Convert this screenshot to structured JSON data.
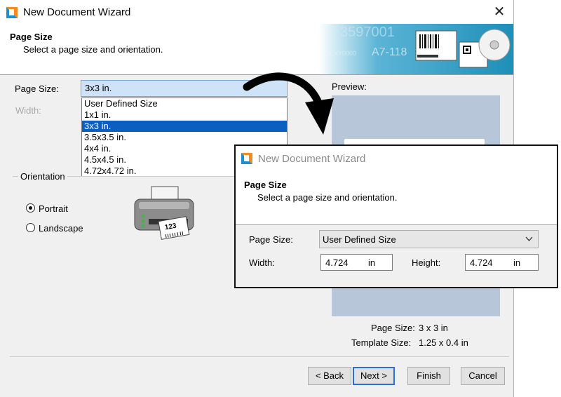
{
  "window": {
    "title": "New Document Wizard",
    "close_glyph": "✕",
    "header_title": "Page Size",
    "header_subtitle": "Select a page size and orientation.",
    "banner_texts": [
      "3597001",
      "A7-118",
      "0EXY0000"
    ]
  },
  "form": {
    "page_size_label": "Page Size:",
    "page_size_value": "3x3 in.",
    "width_label": "Width:",
    "dropdown_options": [
      "User Defined Size",
      "1x1 in.",
      "3x3 in.",
      "3.5x3.5 in.",
      "4x4 in.",
      "4.5x4.5 in.",
      "4.72x4.72 in."
    ],
    "dropdown_selected_index": 2
  },
  "orientation": {
    "label": "Orientation",
    "portrait": "Portrait",
    "landscape": "Landscape",
    "selected": "Portrait",
    "printer_label": "123"
  },
  "preview": {
    "label": "Preview:",
    "page_size_label": "Page Size:",
    "page_size_value": "3 x 3 in",
    "template_size_label": "Template Size:",
    "template_size_value": "1.25 x 0.4 in"
  },
  "buttons": {
    "back": "< Back",
    "next": "Next >",
    "finish": "Finish",
    "cancel": "Cancel"
  },
  "inset": {
    "title": "New Document Wizard",
    "header_title": "Page Size",
    "header_subtitle": "Select a page size and orientation.",
    "page_size_label": "Page Size:",
    "page_size_value": "User Defined Size",
    "width_label": "Width:",
    "width_value": "4.724",
    "width_unit": "in",
    "height_label": "Height:",
    "height_value": "4.724",
    "height_unit": "in"
  },
  "colors": {
    "selection": "#0a5fc0",
    "preview_bg": "#b7c6d9",
    "banner_bg": "#1e8fb8",
    "default_button_border": "#2b6fd6"
  }
}
